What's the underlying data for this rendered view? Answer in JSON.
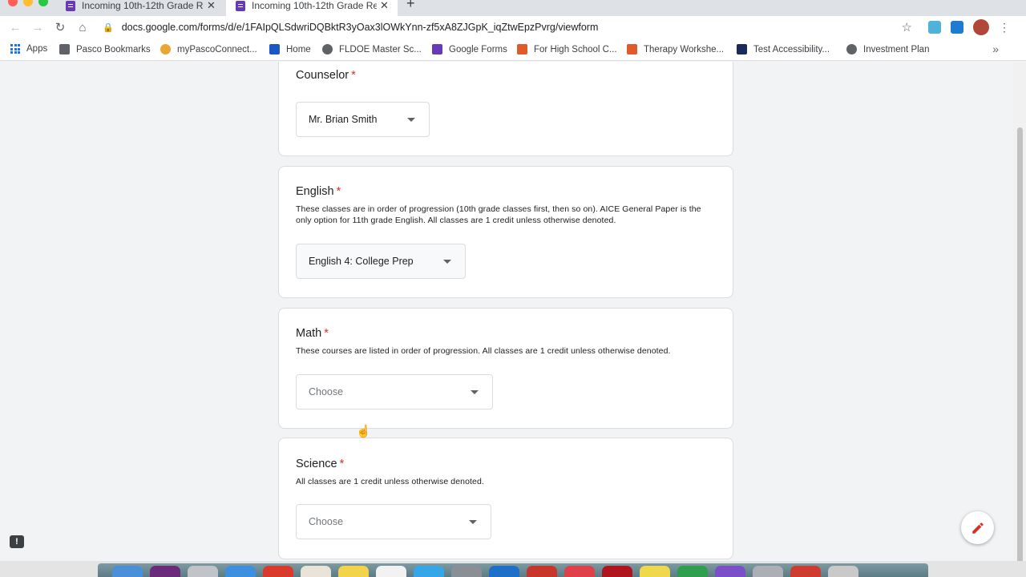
{
  "browser": {
    "tabs": [
      {
        "title": "Incoming 10th-12th Grade Reg",
        "active": false
      },
      {
        "title": "Incoming 10th-12th Grade Reg",
        "active": true
      }
    ],
    "new_tab_label": "+",
    "url": "docs.google.com/forms/d/e/1FAIpQLSdwriDQBktR3yOax3lOWkYnn-zf5xA8ZJGpK_iqZtwEpzPvrg/viewform",
    "bookmarks": [
      {
        "label": "Apps",
        "icon": "apps-grid-icon"
      },
      {
        "label": "Pasco Bookmarks",
        "icon": "folder-icon"
      },
      {
        "label": "myPascoConnect...",
        "icon": "chrome-icon"
      },
      {
        "label": "Home",
        "icon": "home-icon"
      },
      {
        "label": "FLDOE Master Sc...",
        "icon": "globe-icon"
      },
      {
        "label": "Google Forms",
        "icon": "forms-icon"
      },
      {
        "label": "For High School C...",
        "icon": "blogger-icon"
      },
      {
        "label": "Therapy Workshe...",
        "icon": "blogger-icon"
      },
      {
        "label": "Test Accessibility...",
        "icon": "act-icon"
      },
      {
        "label": "Investment Plan",
        "icon": "globe-icon"
      }
    ],
    "bookmarks_overflow": "»"
  },
  "form": {
    "questions": [
      {
        "title": "Counselor",
        "required_mark": "*",
        "description": "",
        "selected": "Mr. Brian Smith"
      },
      {
        "title": "English",
        "required_mark": "*",
        "description": "These classes are in order of progression (10th grade classes first, then so on). AICE General Paper is the only option for 11th grade English. All classes are 1 credit unless otherwise denoted.",
        "selected": "English 4: College Prep"
      },
      {
        "title": "Math",
        "required_mark": "*",
        "description": "These courses are listed in order of progression. All classes are 1 credit unless otherwise denoted.",
        "selected": "Choose"
      },
      {
        "title": "Science",
        "required_mark": "*",
        "description": "All classes are 1 credit unless otherwise denoted.",
        "selected": "Choose"
      }
    ]
  },
  "colors": {
    "required": "#d93025",
    "forms_purple": "#673ab7",
    "page_bg": "#f1f3f4"
  }
}
